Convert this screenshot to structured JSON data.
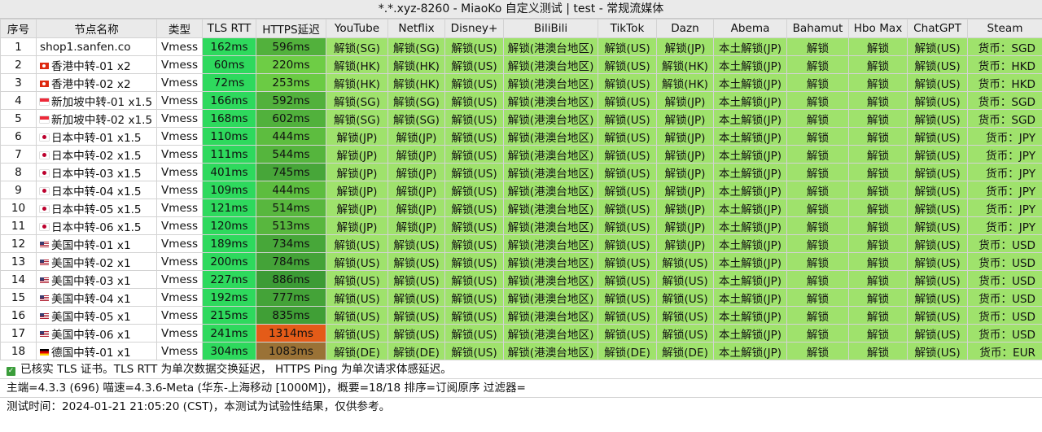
{
  "window_title": "*.*.xyz-8260 - MiaoKo 自定义测试 | test - 常规流媒体",
  "columns": [
    "序号",
    "节点名称",
    "类型",
    "TLS RTT",
    "HTTPS延迟",
    "YouTube",
    "Netflix",
    "Disney+",
    "BiliBili",
    "TikTok",
    "Dazn",
    "Abema",
    "Bahamut",
    "Hbo Max",
    "ChatGPT",
    "Steam"
  ],
  "colors": {
    "unlock_green": "#9fe26c",
    "rtt_green": "#2ed95d",
    "https_green_light": "#6fcf45",
    "https_green_dark": "#3b9a35",
    "https_orange": "#e45b18",
    "https_brown": "#9a7236",
    "header_bg": "#eaeaea"
  },
  "rows": [
    {
      "no": "1",
      "name": "shop1.sanfen.co",
      "flag": "",
      "type": "Vmess",
      "rtt": "162ms",
      "https": "596ms",
      "youtube": "解锁(SG)",
      "netflix": "解锁(SG)",
      "disney": "解锁(US)",
      "bilibili": "解锁(港澳台地区)",
      "tiktok": "解锁(US)",
      "dazn": "解锁(JP)",
      "abema": "本土解锁(JP)",
      "bahamut": "解锁",
      "hbomax": "解锁",
      "chatgpt": "解锁(US)",
      "steam": "货币：SGD"
    },
    {
      "no": "2",
      "name": "香港中转-01 x2",
      "flag": "hk",
      "type": "Vmess",
      "rtt": "60ms",
      "https": "220ms",
      "youtube": "解锁(HK)",
      "netflix": "解锁(HK)",
      "disney": "解锁(US)",
      "bilibili": "解锁(港澳台地区)",
      "tiktok": "解锁(US)",
      "dazn": "解锁(HK)",
      "abema": "本土解锁(JP)",
      "bahamut": "解锁",
      "hbomax": "解锁",
      "chatgpt": "解锁(US)",
      "steam": "货币：HKD"
    },
    {
      "no": "3",
      "name": "香港中转-02 x2",
      "flag": "hk",
      "type": "Vmess",
      "rtt": "72ms",
      "https": "253ms",
      "youtube": "解锁(HK)",
      "netflix": "解锁(HK)",
      "disney": "解锁(US)",
      "bilibili": "解锁(港澳台地区)",
      "tiktok": "解锁(US)",
      "dazn": "解锁(HK)",
      "abema": "本土解锁(JP)",
      "bahamut": "解锁",
      "hbomax": "解锁",
      "chatgpt": "解锁(US)",
      "steam": "货币：HKD"
    },
    {
      "no": "4",
      "name": "新加坡中转-01 x1.5",
      "flag": "sg",
      "type": "Vmess",
      "rtt": "166ms",
      "https": "592ms",
      "youtube": "解锁(SG)",
      "netflix": "解锁(SG)",
      "disney": "解锁(US)",
      "bilibili": "解锁(港澳台地区)",
      "tiktok": "解锁(US)",
      "dazn": "解锁(JP)",
      "abema": "本土解锁(JP)",
      "bahamut": "解锁",
      "hbomax": "解锁",
      "chatgpt": "解锁(US)",
      "steam": "货币：SGD"
    },
    {
      "no": "5",
      "name": "新加坡中转-02 x1.5",
      "flag": "sg",
      "type": "Vmess",
      "rtt": "168ms",
      "https": "602ms",
      "youtube": "解锁(SG)",
      "netflix": "解锁(SG)",
      "disney": "解锁(US)",
      "bilibili": "解锁(港澳台地区)",
      "tiktok": "解锁(US)",
      "dazn": "解锁(JP)",
      "abema": "本土解锁(JP)",
      "bahamut": "解锁",
      "hbomax": "解锁",
      "chatgpt": "解锁(US)",
      "steam": "货币：SGD"
    },
    {
      "no": "6",
      "name": "日本中转-01 x1.5",
      "flag": "jp",
      "type": "Vmess",
      "rtt": "110ms",
      "https": "444ms",
      "youtube": "解锁(JP)",
      "netflix": "解锁(JP)",
      "disney": "解锁(US)",
      "bilibili": "解锁(港澳台地区)",
      "tiktok": "解锁(US)",
      "dazn": "解锁(JP)",
      "abema": "本土解锁(JP)",
      "bahamut": "解锁",
      "hbomax": "解锁",
      "chatgpt": "解锁(US)",
      "steam": "货币：JPY"
    },
    {
      "no": "7",
      "name": "日本中转-02 x1.5",
      "flag": "jp",
      "type": "Vmess",
      "rtt": "111ms",
      "https": "544ms",
      "youtube": "解锁(JP)",
      "netflix": "解锁(JP)",
      "disney": "解锁(US)",
      "bilibili": "解锁(港澳台地区)",
      "tiktok": "解锁(US)",
      "dazn": "解锁(JP)",
      "abema": "本土解锁(JP)",
      "bahamut": "解锁",
      "hbomax": "解锁",
      "chatgpt": "解锁(US)",
      "steam": "货币：JPY"
    },
    {
      "no": "8",
      "name": "日本中转-03 x1.5",
      "flag": "jp",
      "type": "Vmess",
      "rtt": "401ms",
      "https": "745ms",
      "youtube": "解锁(JP)",
      "netflix": "解锁(JP)",
      "disney": "解锁(US)",
      "bilibili": "解锁(港澳台地区)",
      "tiktok": "解锁(US)",
      "dazn": "解锁(JP)",
      "abema": "本土解锁(JP)",
      "bahamut": "解锁",
      "hbomax": "解锁",
      "chatgpt": "解锁(US)",
      "steam": "货币：JPY"
    },
    {
      "no": "9",
      "name": "日本中转-04 x1.5",
      "flag": "jp",
      "type": "Vmess",
      "rtt": "109ms",
      "https": "444ms",
      "youtube": "解锁(JP)",
      "netflix": "解锁(JP)",
      "disney": "解锁(US)",
      "bilibili": "解锁(港澳台地区)",
      "tiktok": "解锁(US)",
      "dazn": "解锁(JP)",
      "abema": "本土解锁(JP)",
      "bahamut": "解锁",
      "hbomax": "解锁",
      "chatgpt": "解锁(US)",
      "steam": "货币：JPY"
    },
    {
      "no": "10",
      "name": "日本中转-05 x1.5",
      "flag": "jp",
      "type": "Vmess",
      "rtt": "121ms",
      "https": "514ms",
      "youtube": "解锁(JP)",
      "netflix": "解锁(JP)",
      "disney": "解锁(US)",
      "bilibili": "解锁(港澳台地区)",
      "tiktok": "解锁(US)",
      "dazn": "解锁(JP)",
      "abema": "本土解锁(JP)",
      "bahamut": "解锁",
      "hbomax": "解锁",
      "chatgpt": "解锁(US)",
      "steam": "货币：JPY"
    },
    {
      "no": "11",
      "name": "日本中转-06 x1.5",
      "flag": "jp",
      "type": "Vmess",
      "rtt": "120ms",
      "https": "513ms",
      "youtube": "解锁(JP)",
      "netflix": "解锁(JP)",
      "disney": "解锁(US)",
      "bilibili": "解锁(港澳台地区)",
      "tiktok": "解锁(US)",
      "dazn": "解锁(JP)",
      "abema": "本土解锁(JP)",
      "bahamut": "解锁",
      "hbomax": "解锁",
      "chatgpt": "解锁(US)",
      "steam": "货币：JPY"
    },
    {
      "no": "12",
      "name": "美国中转-01 x1",
      "flag": "us",
      "type": "Vmess",
      "rtt": "189ms",
      "https": "734ms",
      "youtube": "解锁(US)",
      "netflix": "解锁(US)",
      "disney": "解锁(US)",
      "bilibili": "解锁(港澳台地区)",
      "tiktok": "解锁(US)",
      "dazn": "解锁(JP)",
      "abema": "本土解锁(JP)",
      "bahamut": "解锁",
      "hbomax": "解锁",
      "chatgpt": "解锁(US)",
      "steam": "货币：USD"
    },
    {
      "no": "13",
      "name": "美国中转-02 x1",
      "flag": "us",
      "type": "Vmess",
      "rtt": "200ms",
      "https": "784ms",
      "youtube": "解锁(US)",
      "netflix": "解锁(US)",
      "disney": "解锁(US)",
      "bilibili": "解锁(港澳台地区)",
      "tiktok": "解锁(US)",
      "dazn": "解锁(US)",
      "abema": "本土解锁(JP)",
      "bahamut": "解锁",
      "hbomax": "解锁",
      "chatgpt": "解锁(US)",
      "steam": "货币：USD"
    },
    {
      "no": "14",
      "name": "美国中转-03 x1",
      "flag": "us",
      "type": "Vmess",
      "rtt": "227ms",
      "https": "886ms",
      "youtube": "解锁(US)",
      "netflix": "解锁(US)",
      "disney": "解锁(US)",
      "bilibili": "解锁(港澳台地区)",
      "tiktok": "解锁(US)",
      "dazn": "解锁(US)",
      "abema": "本土解锁(JP)",
      "bahamut": "解锁",
      "hbomax": "解锁",
      "chatgpt": "解锁(US)",
      "steam": "货币：USD"
    },
    {
      "no": "15",
      "name": "美国中转-04 x1",
      "flag": "us",
      "type": "Vmess",
      "rtt": "192ms",
      "https": "777ms",
      "youtube": "解锁(US)",
      "netflix": "解锁(US)",
      "disney": "解锁(US)",
      "bilibili": "解锁(港澳台地区)",
      "tiktok": "解锁(US)",
      "dazn": "解锁(US)",
      "abema": "本土解锁(JP)",
      "bahamut": "解锁",
      "hbomax": "解锁",
      "chatgpt": "解锁(US)",
      "steam": "货币：USD"
    },
    {
      "no": "16",
      "name": "美国中转-05 x1",
      "flag": "us",
      "type": "Vmess",
      "rtt": "215ms",
      "https": "835ms",
      "youtube": "解锁(US)",
      "netflix": "解锁(US)",
      "disney": "解锁(US)",
      "bilibili": "解锁(港澳台地区)",
      "tiktok": "解锁(US)",
      "dazn": "解锁(US)",
      "abema": "本土解锁(JP)",
      "bahamut": "解锁",
      "hbomax": "解锁",
      "chatgpt": "解锁(US)",
      "steam": "货币：USD"
    },
    {
      "no": "17",
      "name": "美国中转-06 x1",
      "flag": "us",
      "type": "Vmess",
      "rtt": "241ms",
      "https": "1314ms",
      "youtube": "解锁(US)",
      "netflix": "解锁(US)",
      "disney": "解锁(US)",
      "bilibili": "解锁(港澳台地区)",
      "tiktok": "解锁(US)",
      "dazn": "解锁(US)",
      "abema": "本土解锁(JP)",
      "bahamut": "解锁",
      "hbomax": "解锁",
      "chatgpt": "解锁(US)",
      "steam": "货币：USD"
    },
    {
      "no": "18",
      "name": "德国中转-01 x1",
      "flag": "de",
      "type": "Vmess",
      "rtt": "304ms",
      "https": "1083ms",
      "youtube": "解锁(DE)",
      "netflix": "解锁(DE)",
      "disney": "解锁(US)",
      "bilibili": "解锁(港澳台地区)",
      "tiktok": "解锁(DE)",
      "dazn": "解锁(DE)",
      "abema": "本土解锁(JP)",
      "bahamut": "解锁",
      "hbomax": "解锁",
      "chatgpt": "解锁(US)",
      "steam": "货币：EUR"
    }
  ],
  "footer": {
    "tls_note": "已核实 TLS 证书。TLS RTT 为单次数据交换延迟， HTTPS Ping 为单次请求体感延迟。",
    "info": "主端=4.3.3 (696) 喵速=4.3.6-Meta (华东-上海移动 [1000M])，概要=18/18 排序=订阅原序 过滤器=",
    "time": "测试时间：2024-01-21 21:05:20 (CST)，本测试为试验性结果，仅供参考。"
  }
}
